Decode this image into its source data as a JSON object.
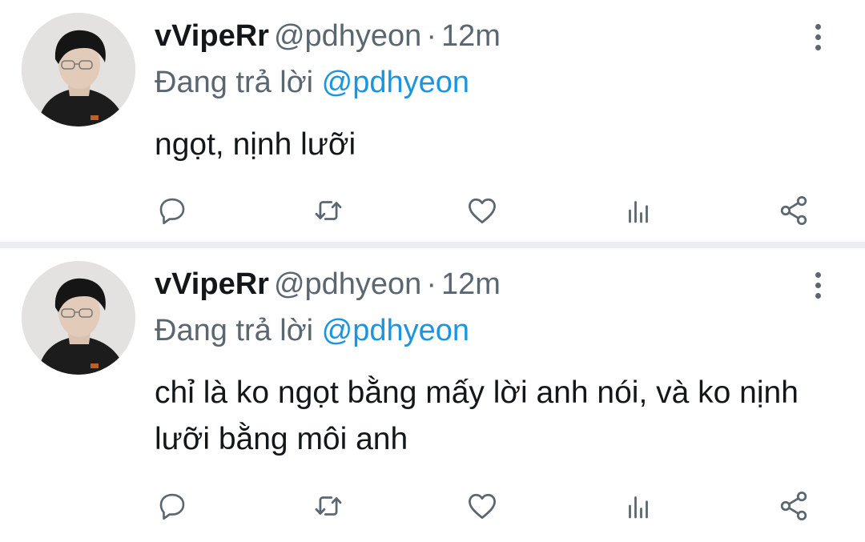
{
  "colors": {
    "text_primary": "#14171a",
    "text_secondary": "#5b6770",
    "accent": "#1b95e0",
    "divider": "#ebeef0"
  },
  "tweets": [
    {
      "display_name": "vVipeRr",
      "handle": "@pdhyeon",
      "separator": "·",
      "time": "12m",
      "reply_prefix": "Đang trả lời",
      "reply_to": "@pdhyeon",
      "text": "ngọt, nịnh lưỡi",
      "avatar_icon": "avatar-photo",
      "menu_icon": "more-vertical-icon",
      "action_icons": [
        "reply-icon",
        "retweet-icon",
        "like-icon",
        "stats-icon",
        "share-icon"
      ]
    },
    {
      "display_name": "vVipeRr",
      "handle": "@pdhyeon",
      "separator": "·",
      "time": "12m",
      "reply_prefix": "Đang trả lời",
      "reply_to": "@pdhyeon",
      "text": "chỉ là ko ngọt bằng mấy lời anh nói, và ko nịnh lưỡi bằng môi anh",
      "avatar_icon": "avatar-photo",
      "menu_icon": "more-vertical-icon",
      "action_icons": [
        "reply-icon",
        "retweet-icon",
        "like-icon",
        "stats-icon",
        "share-icon"
      ]
    }
  ]
}
